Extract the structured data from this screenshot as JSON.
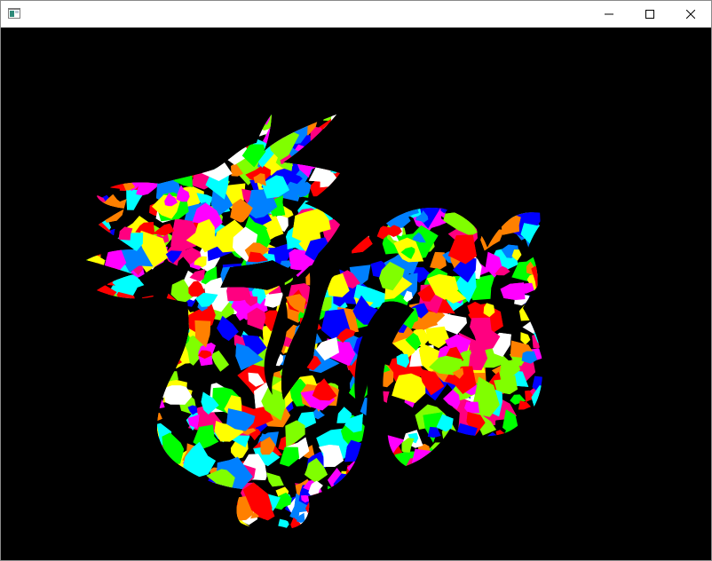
{
  "window": {
    "title": "",
    "controls": {
      "minimize_icon": "minimize-icon",
      "maximize_icon": "maximize-icon",
      "close_icon": "close-icon"
    }
  },
  "viewport": {
    "background": "#000000",
    "subject": "dragon-model",
    "palette": [
      "#ff0000",
      "#00ff00",
      "#0000ff",
      "#ffff00",
      "#ff00ff",
      "#00ffff",
      "#ff8000",
      "#80ff00",
      "#ffffff",
      "#ff0080",
      "#0080ff"
    ]
  }
}
